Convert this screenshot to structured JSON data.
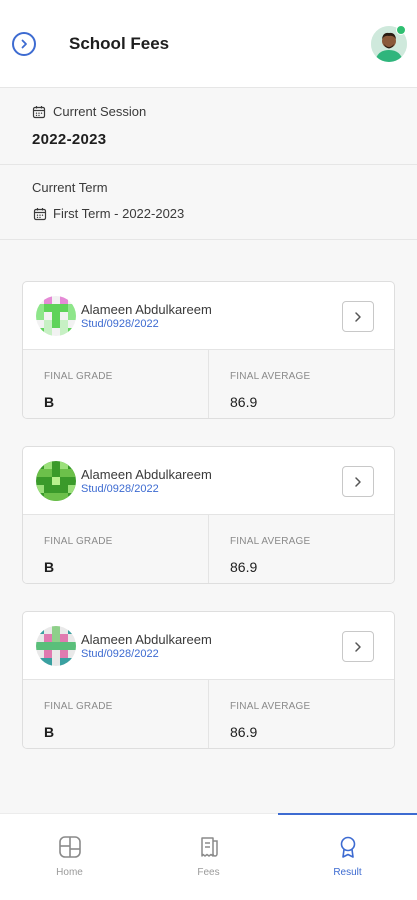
{
  "header": {
    "title": "School Fees",
    "back_icon": "chevron-right-circle-icon",
    "profile_icon": "user-avatar",
    "online_status_color": "#2fbf71"
  },
  "session": {
    "label": "Current Session",
    "value": "2022-2023",
    "icon": "calendar-icon"
  },
  "term": {
    "label": "Current Term",
    "value": "First Term - 2022-2023",
    "icon": "calendar-icon"
  },
  "results": [
    {
      "name": "Alameen Abdulkareem",
      "id": "Stud/0928/2022",
      "grade_label": "FINAL GRADE",
      "grade": "B",
      "average_label": "FINAL AVERAGE",
      "average": "86.9"
    },
    {
      "name": "Alameen Abdulkareem",
      "id": "Stud/0928/2022",
      "grade_label": "FINAL GRADE",
      "grade": "B",
      "average_label": "FINAL AVERAGE",
      "average": "86.9"
    },
    {
      "name": "Alameen Abdulkareem",
      "id": "Stud/0928/2022",
      "grade_label": "FINAL GRADE",
      "grade": "B",
      "average_label": "FINAL AVERAGE",
      "average": "86.9"
    }
  ],
  "nav": [
    {
      "label": "Home",
      "icon": "home-grid-icon",
      "active": false
    },
    {
      "label": "Fees",
      "icon": "receipt-icon",
      "active": false
    },
    {
      "label": "Result",
      "icon": "award-ribbon-icon",
      "active": true
    }
  ],
  "colors": {
    "accent": "#3d6bd1",
    "background": "#f7f7f7"
  }
}
